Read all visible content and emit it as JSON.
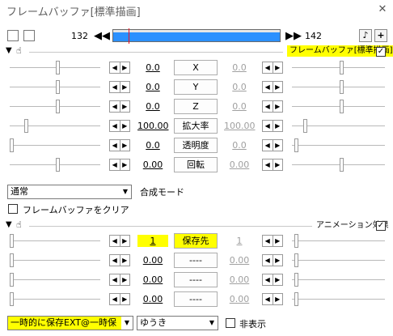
{
  "window": {
    "title": "フレームバッファ[標準描画]",
    "close_glyph": "✕"
  },
  "toolbar": {
    "frame_start": "132",
    "frame_end": "142",
    "skip_back_glyph": "◀◀",
    "skip_fwd_glyph": "▶▶",
    "extra1": "♪",
    "extra2": "+"
  },
  "effect1": {
    "name": "フレームバッファ[標準描画]",
    "checked": "✓",
    "params": [
      {
        "label": "X",
        "left": "0.0",
        "right": "0.0"
      },
      {
        "label": "Y",
        "left": "0.0",
        "right": "0.0"
      },
      {
        "label": "Z",
        "left": "0.0",
        "right": "0.0"
      },
      {
        "label": "拡大率",
        "left": "100.00",
        "right": "100.00"
      },
      {
        "label": "透明度",
        "left": "0.0",
        "right": "0.0"
      },
      {
        "label": "回転",
        "left": "0.00",
        "right": "0.00"
      }
    ],
    "blend_mode": "通常",
    "blend_label": "合成モード",
    "clear_label": "フレームバッファをクリア"
  },
  "effect2": {
    "name": "アニメーション効果",
    "checked": "✓",
    "params": [
      {
        "label": "保存先",
        "left": "1",
        "right": "1"
      },
      {
        "label": "----",
        "left": "0.00",
        "right": "0.00"
      },
      {
        "label": "----",
        "left": "0.00",
        "right": "0.00"
      },
      {
        "label": "----",
        "left": "0.00",
        "right": "0.00"
      }
    ],
    "script": "一時的に保存EXT@一時保",
    "author": "ゆうき",
    "hide_label": "非表示"
  },
  "colors": {
    "highlight": "#ffff00",
    "timeline": "#2b90ff",
    "playhead": "#e81123"
  }
}
